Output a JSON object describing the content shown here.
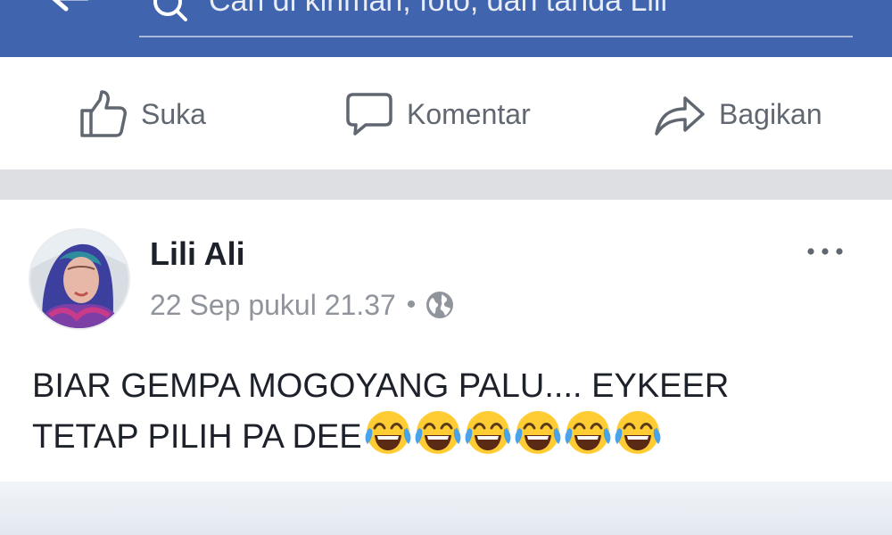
{
  "search": {
    "placeholder": "Cari di kiriman, foto, dan tanda Lili"
  },
  "actions": {
    "like_label": "Suka",
    "comment_label": "Komentar",
    "share_label": "Bagikan"
  },
  "post": {
    "author": "Lili Ali",
    "timestamp": "22 Sep pukul 21.37",
    "separator": "•",
    "privacy_icon": "globe-icon",
    "text_line1": "BIAR GEMPA MOGOYANG PALU.... EYKEER",
    "text_line2": "TETAP PILIH PA DEE",
    "emoji": "face-with-tears-of-joy",
    "emoji_count": 6
  },
  "colors": {
    "brand_blue": "#4064ad",
    "action_gray": "#606770",
    "meta_gray": "#90949c",
    "text_dark": "#1d2129",
    "separator": "#dddfe2"
  }
}
